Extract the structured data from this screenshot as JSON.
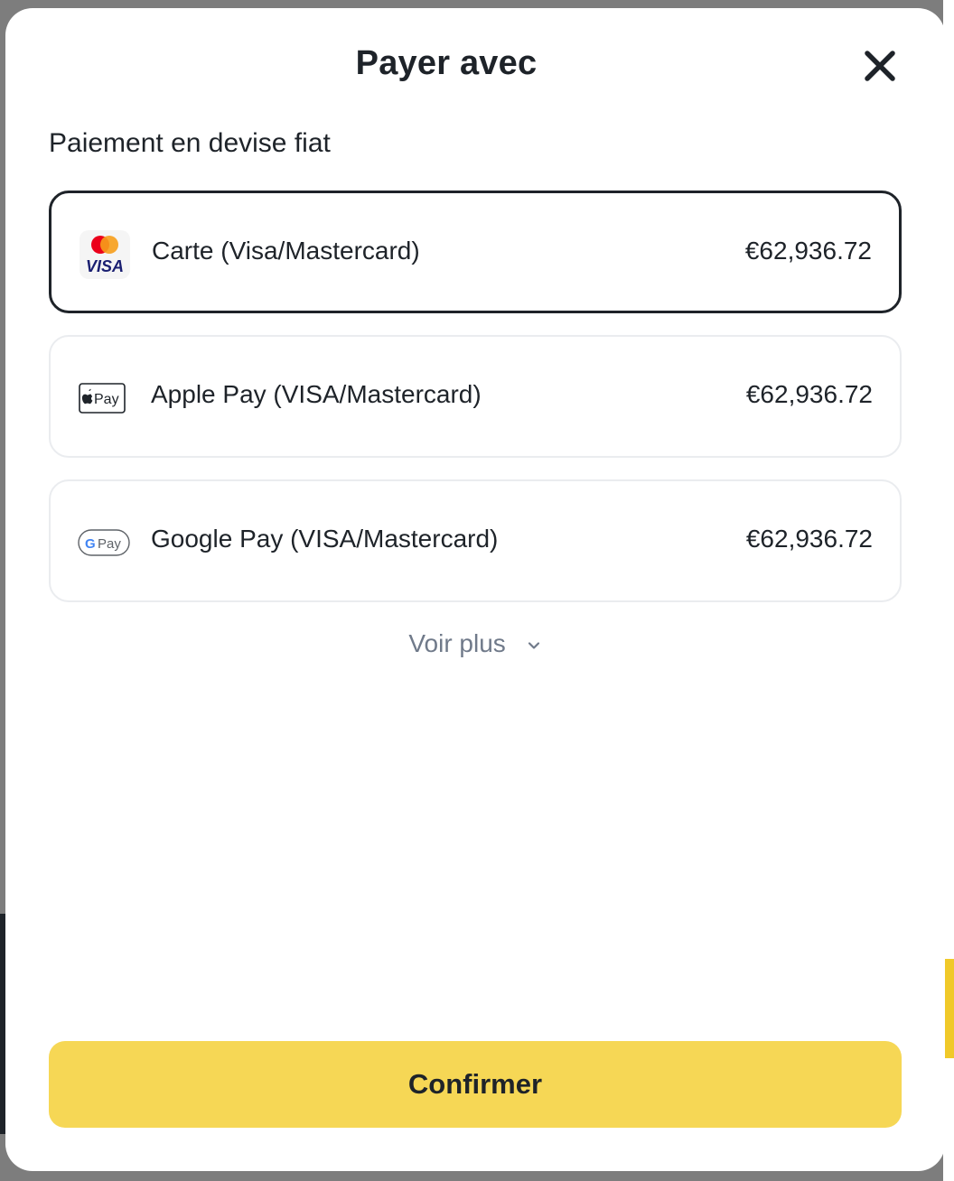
{
  "modal": {
    "title": "Payer avec",
    "section_title": "Paiement en devise fiat",
    "methods": [
      {
        "label": "Carte (Visa/Mastercard)",
        "amount": "€62,936.72",
        "icon": "visa-mastercard-icon",
        "selected": true,
        "icon_text": "VISA"
      },
      {
        "label": "Apple Pay (VISA/Mastercard)",
        "amount": "€62,936.72",
        "icon": "apple-pay-icon",
        "selected": false,
        "icon_text": "Pay"
      },
      {
        "label": "Google Pay (VISA/Mastercard)",
        "amount": "€62,936.72",
        "icon": "google-pay-icon",
        "selected": false,
        "icon_text": "Pay",
        "icon_letter": "G"
      }
    ],
    "see_more_label": "Voir plus",
    "confirm_label": "Confirmer"
  },
  "colors": {
    "accent": "#f6d755",
    "text": "#1e2329",
    "muted": "#707a8a",
    "border": "#eaecef"
  }
}
